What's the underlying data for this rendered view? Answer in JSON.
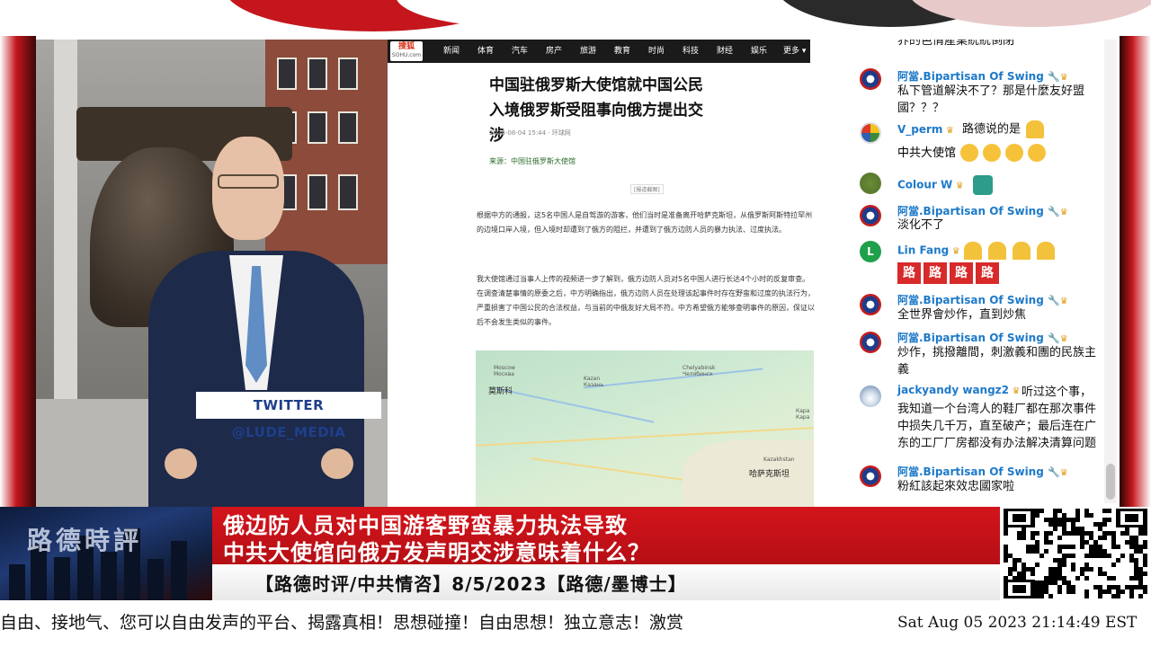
{
  "overlay": {
    "twitter_handle": "TWITTER  @LUDE_MEDIA"
  },
  "article": {
    "site_logo": "搜狐",
    "site_logo_sub": "SOHU.com",
    "nav": [
      "新闻",
      "体育",
      "汽车",
      "房产",
      "旅游",
      "教育",
      "时尚",
      "科技",
      "财经",
      "娱乐",
      "更多 ▾"
    ],
    "title": "中国驻俄罗斯大使馆就中国公民入境俄罗斯受阻事向俄方提出交涉",
    "meta": "2023-08-04 15:44 · 环球网",
    "source": "来源：中国驻俄罗斯大使馆",
    "screenshot_note": "[报道截图]",
    "paragraphs": [
      "根据中方的通报，这5名中国人是自驾游的游客，他们当时是准备离开哈萨克斯坦，从俄罗斯阿斯特拉罕州的边境口岸入境，但入境时却遭到了俄方的阻拦，并遭到了俄方边防人员的暴力执法、过度执法。",
      "我大使馆通过当事人上传的视频进一步了解到，俄方边防人员对5名中国人进行长达4个小时的反复审查。在调查清楚事情的原委之后，中方明确指出，俄方边防人员在处理该起事件时存在野蛮和过度的执法行为，严重损害了中国公民的合法权益，与当前的中俄友好大局不符。中方希望俄方能够查明事件的原因，保证以后不会发生类似的事件。"
    ],
    "map_labels": {
      "moscow_en": "Moscow\nМосква",
      "moscow_cn": "莫斯科",
      "kazan": "Kazan\nКазань",
      "chelyabinsk": "Chelyabinsk\nЧелябинск",
      "kazakhstan_en": "Kazakhstan",
      "kazakhstan_cn": "哈萨克斯坦",
      "karaganda": "Кара\nКара"
    }
  },
  "chat": {
    "messages": [
      {
        "text": "界的色情產業統統倒閉"
      },
      {
        "author": "阿當.Bipartisan Of Swing",
        "text": "私下管道解決不了？那是什麼友好盟國？？？"
      },
      {
        "author": "V_perm",
        "text_a": "路德说的是",
        "text_b": "中共大使馆"
      },
      {
        "author": "Colour W"
      },
      {
        "author": "阿當.Bipartisan Of Swing",
        "text": "淡化不了"
      },
      {
        "author": "Lin Fang",
        "avatar_letter": "L",
        "tiles": [
          "路",
          "路",
          "路",
          "路"
        ]
      },
      {
        "author": "阿當.Bipartisan Of Swing",
        "text": "全世界會炒作，直到炒焦"
      },
      {
        "author": "阿當.Bipartisan Of Swing",
        "text": "炒作，挑撥離間，刺激義和團的民族主義"
      },
      {
        "author": "jackyandy wangz2",
        "text": "听过这个事，我知道一个台湾人的鞋厂都在那次事件中损失几千万，直至破产；最后连在广东的工厂厂房都没有办法解决清算问题"
      },
      {
        "author": "阿當.Bipartisan Of Swing",
        "text": "粉紅該起來效忠國家啦"
      }
    ]
  },
  "lower_third": {
    "logo": "路德時評",
    "headline_1": "俄边防人员对中国游客野蛮暴力执法导致",
    "headline_2": "中共大使馆向俄方发声明交涉意味着什么？",
    "subline": "【路德时评/中共情咨】8/5/2023【路德/墨博士】"
  },
  "ticker": {
    "text": "自由、接地气、您可以自由发声的平台、揭露真相！思想碰撞！自由思想！独立意志！激赏",
    "time": "Sat Aug 05 2023 21:14:49 EST"
  },
  "colors": {
    "headline_red": "#d3141b",
    "chat_author": "#1e7ac8",
    "twitter_text": "#1f3f8a"
  }
}
